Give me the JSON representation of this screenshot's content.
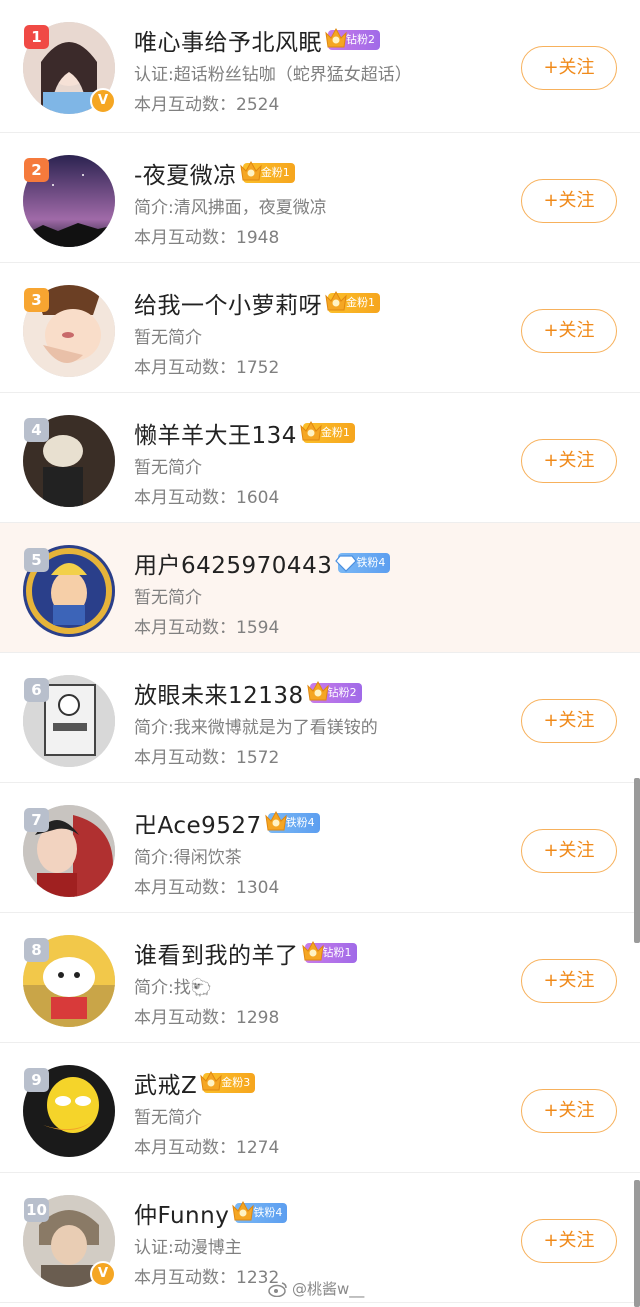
{
  "follow_label": "+关注",
  "count_prefix": "本月互动数：",
  "watermark": "@桃酱w__",
  "colors": {
    "rank1": "#f04a45",
    "rank2": "#f57a3c",
    "rank3": "#f7a531",
    "rank_other": "#b8bfcc",
    "accent": "#f08a1a"
  },
  "users": [
    {
      "rank": "1",
      "name": "唯心事给予北风眠",
      "badge_level": "钻粉2",
      "badge_type": "diamond",
      "sub": "认证:超话粉丝钻咖（蛇界猛女超话）",
      "count": "2524",
      "verified": true,
      "following_button": true
    },
    {
      "rank": "2",
      "name": "-夜夏微凉",
      "badge_level": "金粉1",
      "badge_type": "gold",
      "sub": "简介:清风拂面，夜夏微凉",
      "count": "1948",
      "verified": false,
      "following_button": true
    },
    {
      "rank": "3",
      "name": "给我一个小萝莉呀",
      "badge_level": "金粉1",
      "badge_type": "gold",
      "sub": "暂无简介",
      "count": "1752",
      "verified": false,
      "following_button": true
    },
    {
      "rank": "4",
      "name": "懒羊羊大王134",
      "badge_level": "金粉1",
      "badge_type": "gold",
      "sub": "暂无简介",
      "count": "1604",
      "verified": false,
      "following_button": true
    },
    {
      "rank": "5",
      "name": "用户6425970443",
      "badge_level": "铁粉4",
      "badge_type": "iron",
      "sub": "暂无简介",
      "count": "1594",
      "verified": false,
      "following_button": false
    },
    {
      "rank": "6",
      "name": "放眼未来12138",
      "badge_level": "钻粉2",
      "badge_type": "diamond",
      "sub": "简介:我来微博就是为了看镁铵的",
      "count": "1572",
      "verified": false,
      "following_button": true
    },
    {
      "rank": "7",
      "name": "卍Ace9527",
      "badge_level": "铁粉4",
      "badge_type": "iron",
      "sub": "简介:得闲饮茶",
      "count": "1304",
      "verified": false,
      "following_button": true
    },
    {
      "rank": "8",
      "name": "谁看到我的羊了",
      "badge_level": "钻粉1",
      "badge_type": "diamond",
      "sub": "简介:找🐑",
      "count": "1298",
      "verified": false,
      "following_button": true
    },
    {
      "rank": "9",
      "name": "武戒Z",
      "badge_level": "金粉3",
      "badge_type": "gold",
      "sub": "暂无简介",
      "count": "1274",
      "verified": false,
      "following_button": true
    },
    {
      "rank": "10",
      "name": "仲Funny",
      "badge_level": "铁粉4",
      "badge_type": "iron",
      "sub": "认证:动漫博主",
      "count": "1232",
      "verified": true,
      "following_button": true
    }
  ]
}
